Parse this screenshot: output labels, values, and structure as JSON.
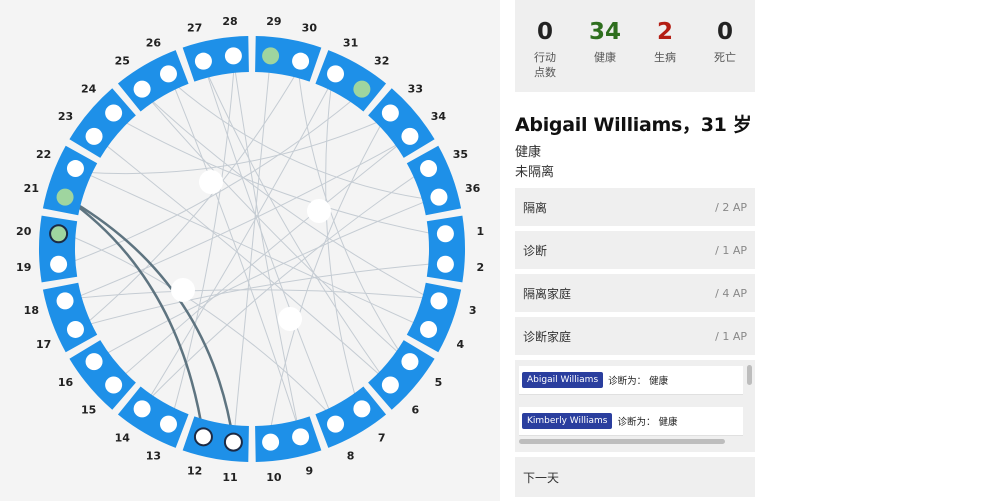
{
  "stats": [
    {
      "value": "0",
      "label": "行动点数",
      "color": "#222222"
    },
    {
      "value": "34",
      "label": "健康",
      "color": "#2e6e1e"
    },
    {
      "value": "2",
      "label": "生病",
      "color": "#b41e14"
    },
    {
      "value": "0",
      "label": "死亡",
      "color": "#222222"
    }
  ],
  "person": {
    "name": "Abigail Williams，31 岁",
    "status": "健康",
    "quarantine": "未隔离"
  },
  "actions": [
    {
      "label": "隔离",
      "cost": "/ 2 AP"
    },
    {
      "label": "诊断",
      "cost": "/ 1 AP"
    },
    {
      "label": "隔离家庭",
      "cost": "/ 4 AP"
    },
    {
      "label": "诊断家庭",
      "cost": "/ 1 AP"
    }
  ],
  "log": [
    {
      "name": "Abigail Williams",
      "text": "诊断为： 健康"
    },
    {
      "name": "Kimberly Williams",
      "text": "诊断为： 健康"
    }
  ],
  "next_day": "下一天",
  "board": {
    "house_labels": [
      "1",
      "2",
      "3",
      "4",
      "5",
      "6",
      "7",
      "8",
      "9",
      "10",
      "11",
      "12",
      "13",
      "14",
      "15",
      "16",
      "17",
      "18",
      "19",
      "20",
      "21",
      "22",
      "23",
      "24",
      "25",
      "26",
      "27",
      "28",
      "29",
      "30",
      "31",
      "32",
      "33",
      "34",
      "35",
      "36"
    ],
    "colors": {
      "house": "#1e90e8",
      "person": "#ffffff",
      "healthy": "#9fd59f",
      "edge": "#c5ccd3",
      "highlight": "#5e7480"
    },
    "green_people": [
      29,
      32,
      21,
      20
    ],
    "ringed_people": [
      20,
      12,
      11
    ],
    "selected_person": 21
  }
}
